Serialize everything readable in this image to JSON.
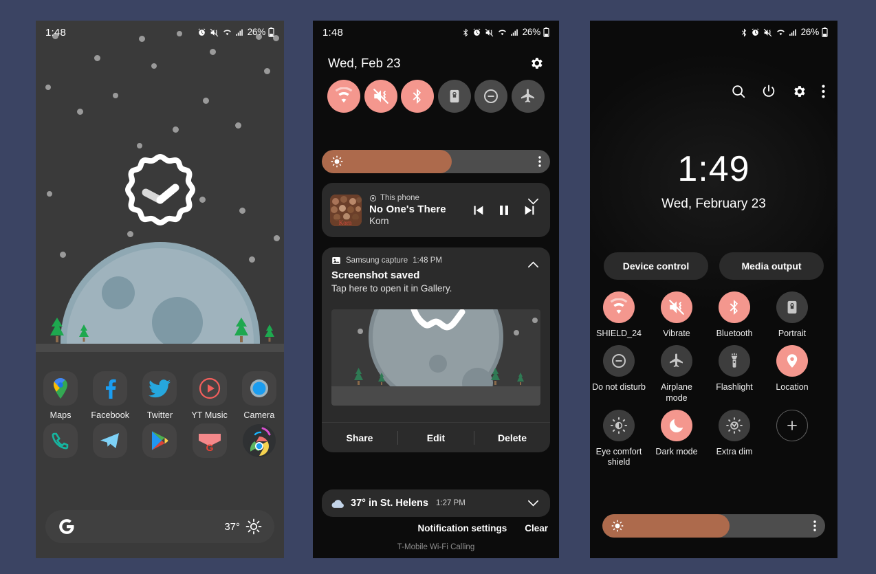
{
  "canvas": {
    "bg": "#3b4463"
  },
  "accent": {
    "on": "#f4978e",
    "off": "#4a4a4a",
    "brightness_fill": "#ad6a4c"
  },
  "phone1": {
    "statusbar": {
      "time": "1:48",
      "battery_pct": "26%"
    },
    "apps_row1": [
      {
        "label": "Maps",
        "icon": "maps-icon"
      },
      {
        "label": "Facebook",
        "icon": "facebook-icon"
      },
      {
        "label": "Twitter",
        "icon": "twitter-icon"
      },
      {
        "label": "YT Music",
        "icon": "youtube-music-icon"
      },
      {
        "label": "Camera",
        "icon": "camera-icon"
      }
    ],
    "apps_row2": [
      {
        "label": "",
        "icon": "phone-icon"
      },
      {
        "label": "",
        "icon": "telegram-icon"
      },
      {
        "label": "",
        "icon": "play-store-icon"
      },
      {
        "label": "",
        "icon": "gmail-icon"
      },
      {
        "label": "",
        "icon": "chrome-icon"
      }
    ],
    "search": {
      "logo": "google-g-icon",
      "temperature": "37°",
      "weather_icon": "sunny-icon"
    }
  },
  "phone2": {
    "statusbar": {
      "time": "1:48",
      "battery_pct": "26%"
    },
    "header": {
      "date": "Wed, Feb 23",
      "settings_icon": "gear-icon"
    },
    "quick_tiles": [
      {
        "name": "wifi-tile",
        "icon": "wifi-icon",
        "state": "on"
      },
      {
        "name": "sound-tile",
        "icon": "vibrate-mute-icon",
        "state": "on"
      },
      {
        "name": "bluetooth-tile",
        "icon": "bluetooth-icon",
        "state": "on"
      },
      {
        "name": "rotation-tile",
        "icon": "portrait-lock-icon",
        "state": "off"
      },
      {
        "name": "dnd-tile",
        "icon": "do-not-disturb-icon",
        "state": "off"
      },
      {
        "name": "airplane-tile",
        "icon": "airplane-icon",
        "state": "off"
      }
    ],
    "brightness": {
      "value_pct": 57,
      "icon": "brightness-sun-icon",
      "menu_icon": "more-vertical-icon"
    },
    "media": {
      "source": "This phone",
      "source_icon": "output-target-icon",
      "title": "No One's There",
      "artist": "Korn",
      "expand_icon": "chevron-down-icon",
      "controls": [
        "previous-icon",
        "pause-icon",
        "next-icon"
      ]
    },
    "screenshot_notification": {
      "app_icon": "image-icon",
      "app_name": "Samsung capture",
      "time": "1:48 PM",
      "collapse_icon": "chevron-up-icon",
      "title": "Screenshot saved",
      "subtitle": "Tap here to open it in Gallery.",
      "actions": [
        "Share",
        "Edit",
        "Delete"
      ]
    },
    "weather_notification": {
      "icon": "cloud-icon",
      "text": "37° in St. Helens",
      "time": "1:27 PM",
      "expand_icon": "chevron-down-icon"
    },
    "footer": {
      "notification_settings": "Notification settings",
      "clear": "Clear"
    },
    "carrier": "T-Mobile Wi-Fi Calling"
  },
  "phone3": {
    "statusbar": {
      "battery_pct": "26%"
    },
    "header_icons": [
      "search-icon",
      "power-icon",
      "gear-icon",
      "more-vertical-icon"
    ],
    "clock": {
      "time": "1:49",
      "date": "Wed, February 23"
    },
    "pills": [
      {
        "label": "Device control"
      },
      {
        "label": "Media output"
      }
    ],
    "tiles": [
      {
        "label": "SHIELD_24",
        "icon": "wifi-icon",
        "state": "on"
      },
      {
        "label": "Vibrate",
        "icon": "vibrate-mute-icon",
        "state": "on"
      },
      {
        "label": "Bluetooth",
        "icon": "bluetooth-icon",
        "state": "on"
      },
      {
        "label": "Portrait",
        "icon": "portrait-lock-icon",
        "state": "off"
      },
      {
        "label": "Do not disturb",
        "icon": "do-not-disturb-icon",
        "state": "off"
      },
      {
        "label": "Airplane mode",
        "icon": "airplane-icon",
        "state": "off"
      },
      {
        "label": "Flashlight",
        "icon": "flashlight-icon",
        "state": "off"
      },
      {
        "label": "Location",
        "icon": "location-pin-icon",
        "state": "on"
      },
      {
        "label": "Eye comfort shield",
        "icon": "eye-comfort-icon",
        "state": "off"
      },
      {
        "label": "Dark mode",
        "icon": "moon-icon",
        "state": "on"
      },
      {
        "label": "Extra dim",
        "icon": "extra-dim-icon",
        "state": "off"
      },
      {
        "label": "",
        "icon": "plus-icon",
        "state": "add"
      }
    ],
    "brightness": {
      "value_pct": 57,
      "icon": "brightness-sun-icon",
      "menu_icon": "more-vertical-icon"
    }
  }
}
